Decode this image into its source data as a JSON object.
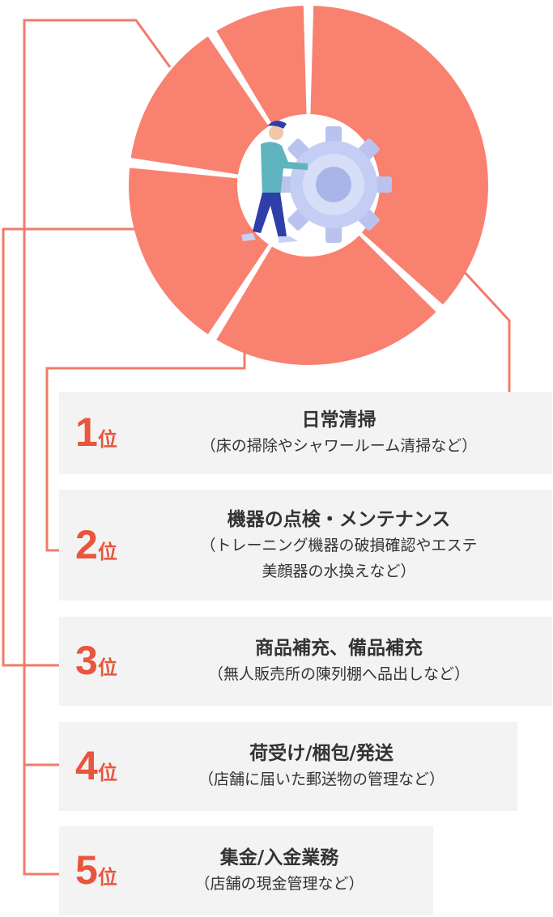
{
  "chart_data": {
    "type": "pie",
    "variant": "donut",
    "categories": [
      "日常清掃",
      "機器の点検・メンテナンス",
      "商品補充、備品補充",
      "荷受け/梱包/発送",
      "集金/入金業務"
    ],
    "values": [
      37,
      22,
      18,
      14,
      9
    ],
    "color": "#f98170",
    "accent": "#e9553d",
    "connector_color": "#f07c6b",
    "center_icon": "worker-turning-gear-illustration"
  },
  "ranks": [
    {
      "num": "1",
      "unit": "位",
      "title": "日常清掃",
      "desc": [
        "（床の掃除やシャワールーム清掃など）"
      ]
    },
    {
      "num": "2",
      "unit": "位",
      "title": "機器の点検・メンテナンス",
      "desc": [
        "（トレーニング機器の破損確認やエステ",
        "美顔器の水換えなど）"
      ]
    },
    {
      "num": "3",
      "unit": "位",
      "title": "商品補充、備品補充",
      "desc": [
        "（無人販売所の陳列棚へ品出しなど）"
      ]
    },
    {
      "num": "4",
      "unit": "位",
      "title": "荷受け/梱包/発送",
      "desc": [
        "（店舗に届いた郵送物の管理など）"
      ]
    },
    {
      "num": "5",
      "unit": "位",
      "title": "集金/入金業務",
      "desc": [
        "（店舗の現金管理など）"
      ]
    }
  ]
}
